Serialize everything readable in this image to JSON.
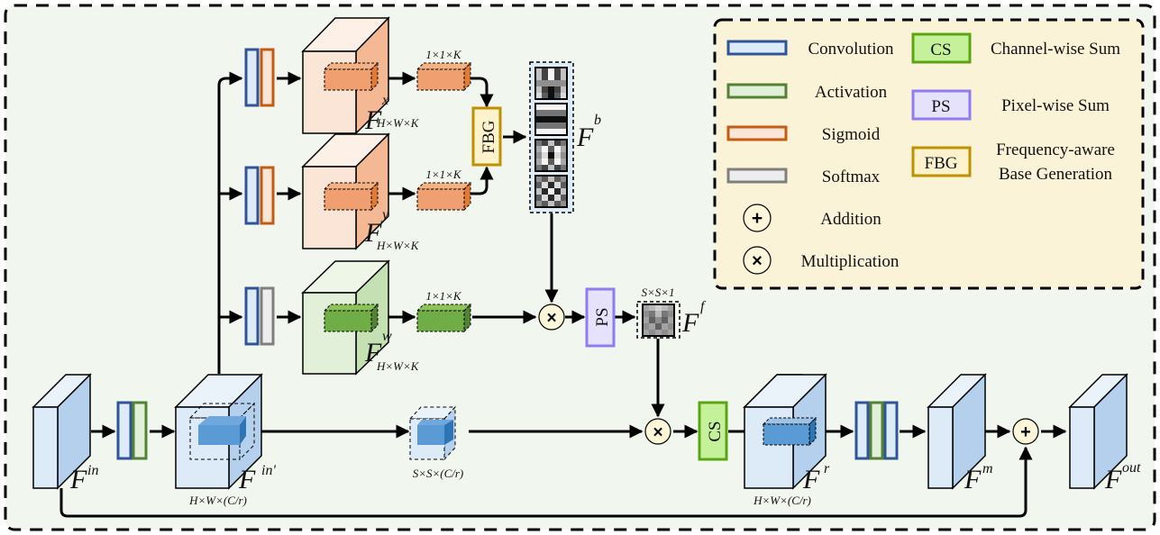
{
  "diagram": {
    "title": "",
    "colors": {
      "background": "#f1f6ee",
      "legend_bg": "#fbf3d8",
      "conv_fill": "#ddeaf7",
      "conv_stroke": "#2f5597",
      "act_fill": "#e2efd9",
      "act_stroke": "#548235",
      "sig_fill": "#fbe5d6",
      "sig_stroke": "#c55a11",
      "soft_fill": "#ededed",
      "soft_stroke": "#7f7f7f",
      "cs_fill": "#c5f19b",
      "cs_stroke": "#5aa612",
      "ps_fill": "#e6e2fb",
      "ps_stroke": "#8f7cf2",
      "fbg_fill": "#fff2cc",
      "fbg_stroke": "#bf9000",
      "op_fill": "#fdf6d8"
    },
    "legend": {
      "items": [
        {
          "key": "conv",
          "label": "Convolution"
        },
        {
          "key": "act",
          "label": "Activation"
        },
        {
          "key": "sig",
          "label": "Sigmoid"
        },
        {
          "key": "soft",
          "label": "Softmax"
        },
        {
          "key": "add",
          "label": "Addition",
          "symbol": "+"
        },
        {
          "key": "mul",
          "label": "Multiplication",
          "symbol": "×"
        }
      ],
      "blocks": [
        {
          "key": "cs",
          "abbr": "CS",
          "label": "Channel-wise Sum"
        },
        {
          "key": "ps",
          "abbr": "PS",
          "label": "Pixel-wise Sum"
        },
        {
          "key": "fbg",
          "abbr": "FBG",
          "label_line1": "Frequency-aware",
          "label_line2": "Base Generation"
        }
      ]
    },
    "nodes": {
      "fx": {
        "name": "F",
        "sup": "x",
        "dim": "H×W×K",
        "vec_dim": "1×1×K"
      },
      "fy": {
        "name": "F",
        "sup": "y",
        "dim": "H×W×K",
        "vec_dim": "1×1×K"
      },
      "fw": {
        "name": "F",
        "sup": "w",
        "dim": "H×W×K",
        "vec_dim": "1×1×K"
      },
      "fb": {
        "name": "F",
        "sup": "b"
      },
      "ff": {
        "name": "F",
        "sup": "f",
        "dim": "S×S×1"
      },
      "fin": {
        "name": "F",
        "sup": "in"
      },
      "finp": {
        "name": "F",
        "sup": "in'",
        "dim": "H×W×(C/r)"
      },
      "patch": {
        "dim": "S×S×(C/r)"
      },
      "fr": {
        "name": "F",
        "sup": "r",
        "dim": "H×W×(C/r)"
      },
      "fm": {
        "name": "F",
        "sup": "m"
      },
      "fout": {
        "name": "F",
        "sup": "out"
      }
    },
    "ops": {
      "fbg": "FBG",
      "ps": "PS",
      "cs": "CS",
      "mul": "×",
      "add": "+"
    }
  }
}
